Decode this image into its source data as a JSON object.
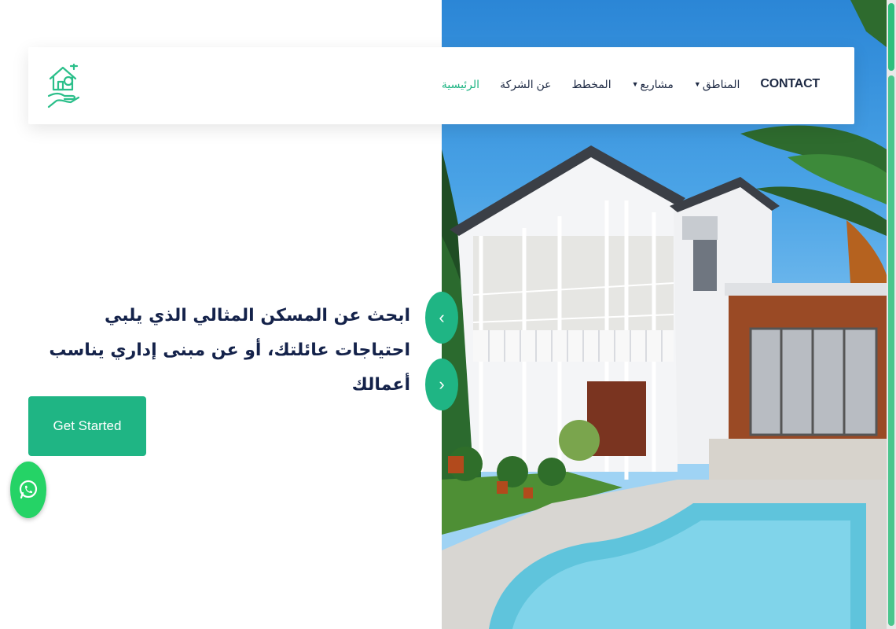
{
  "nav": {
    "items": [
      {
        "label": "الرئيسية",
        "active": true,
        "has_dropdown": false
      },
      {
        "label": "عن الشركة",
        "active": false,
        "has_dropdown": false
      },
      {
        "label": "المخطط",
        "active": false,
        "has_dropdown": false
      },
      {
        "label": "مشاريع",
        "active": false,
        "has_dropdown": true
      },
      {
        "label": "المناطق",
        "active": false,
        "has_dropdown": true
      }
    ],
    "contact_label": "CONTACT"
  },
  "hero": {
    "headline": "ابحث عن المسكن المثالي الذي يلبي احتياجات عائلتك، أو عن مبنى إداري يناسب أعمالك",
    "cta_label": "Get Started"
  },
  "icons": {
    "logo": "house-hand-logo-icon",
    "arrow_up": "chevron-up-icon",
    "arrow_down": "chevron-down-icon",
    "whatsapp": "whatsapp-icon"
  },
  "colors": {
    "accent": "#1fb584",
    "heading": "#14224a",
    "whatsapp": "#25d366"
  }
}
